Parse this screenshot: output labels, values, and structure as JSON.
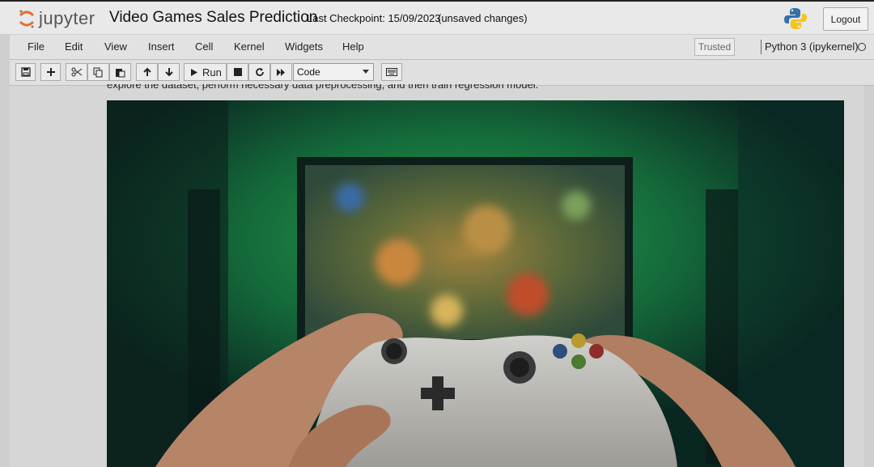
{
  "header": {
    "logo_text": "jupyter",
    "notebook_title": "Video Games Sales Prediction",
    "last_checkpoint": "Last Checkpoint: 15/09/2023",
    "unsaved_status": "(unsaved changes)",
    "logout_label": "Logout"
  },
  "menubar": {
    "items": [
      "File",
      "Edit",
      "View",
      "Insert",
      "Cell",
      "Kernel",
      "Widgets",
      "Help"
    ],
    "trusted_label": "Trusted",
    "kernel_name": "Python 3 (ipykernel)"
  },
  "toolbar": {
    "run_label": "Run",
    "cell_type_value": "Code",
    "icons": [
      "save-icon",
      "plus-icon",
      "cut-icon",
      "copy-icon",
      "paste-icon",
      "arrow-up-icon",
      "arrow-down-icon",
      "play-icon",
      "stop-icon",
      "restart-icon",
      "fast-forward-icon",
      "keyboard-icon"
    ]
  },
  "content": {
    "partial_text": "explore the dataset, perform necessary data preprocessing, and then train regression model."
  },
  "colors": {
    "overlay_dim": "#cfcfcf",
    "image_green_glow": "#1a8a45",
    "python_blue": "#3572a5",
    "python_yellow": "#f5c518",
    "jupyter_orange": "#e46e2e"
  }
}
